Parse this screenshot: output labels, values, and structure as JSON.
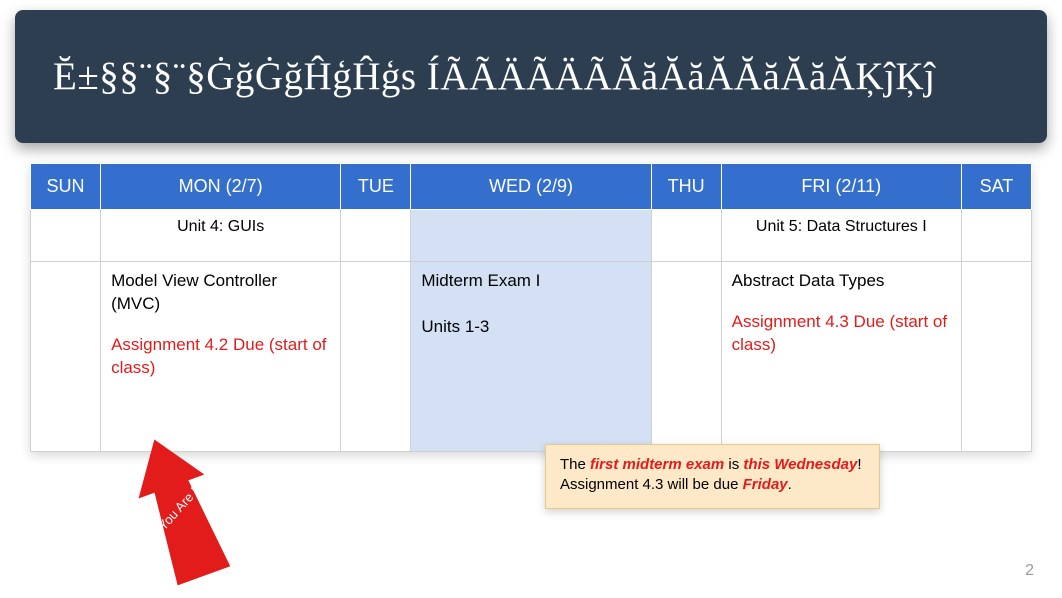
{
  "header": {
    "title": "Ĕ±§§¨§¨§ĠğĠğĤģĤģs ÍÃÃÄÃÄÃĂăĂăĂĂăĂăĂĶĵĶĵ"
  },
  "calendar": {
    "days": {
      "sun": "SUN",
      "mon": "MON (2/7)",
      "tue": "TUE",
      "wed": "WED (2/9)",
      "thu": "THU",
      "fri": "FRI (2/11)",
      "sat": "SAT"
    },
    "units": {
      "mon": "Unit 4: GUIs",
      "fri": "Unit 5: Data Structures I"
    },
    "content": {
      "mon": {
        "topic": "Model View Controller (MVC)",
        "assignment": "Assignment 4.2 Due (start of class)"
      },
      "wed": {
        "line1": "Midterm Exam I",
        "line2": "Units 1-3"
      },
      "fri": {
        "topic": "Abstract Data Types",
        "assignment": "Assignment 4.3 Due (start of class)"
      }
    }
  },
  "note": {
    "pre": "The ",
    "first_em": "first midterm exam",
    "mid1": " is ",
    "second_em": "this Wednesday",
    "mid2": "! Assignment 4.3 will be due ",
    "third_em": "Friday",
    "post": "."
  },
  "arrow": {
    "label": "You Are Here"
  },
  "page_number": "2"
}
